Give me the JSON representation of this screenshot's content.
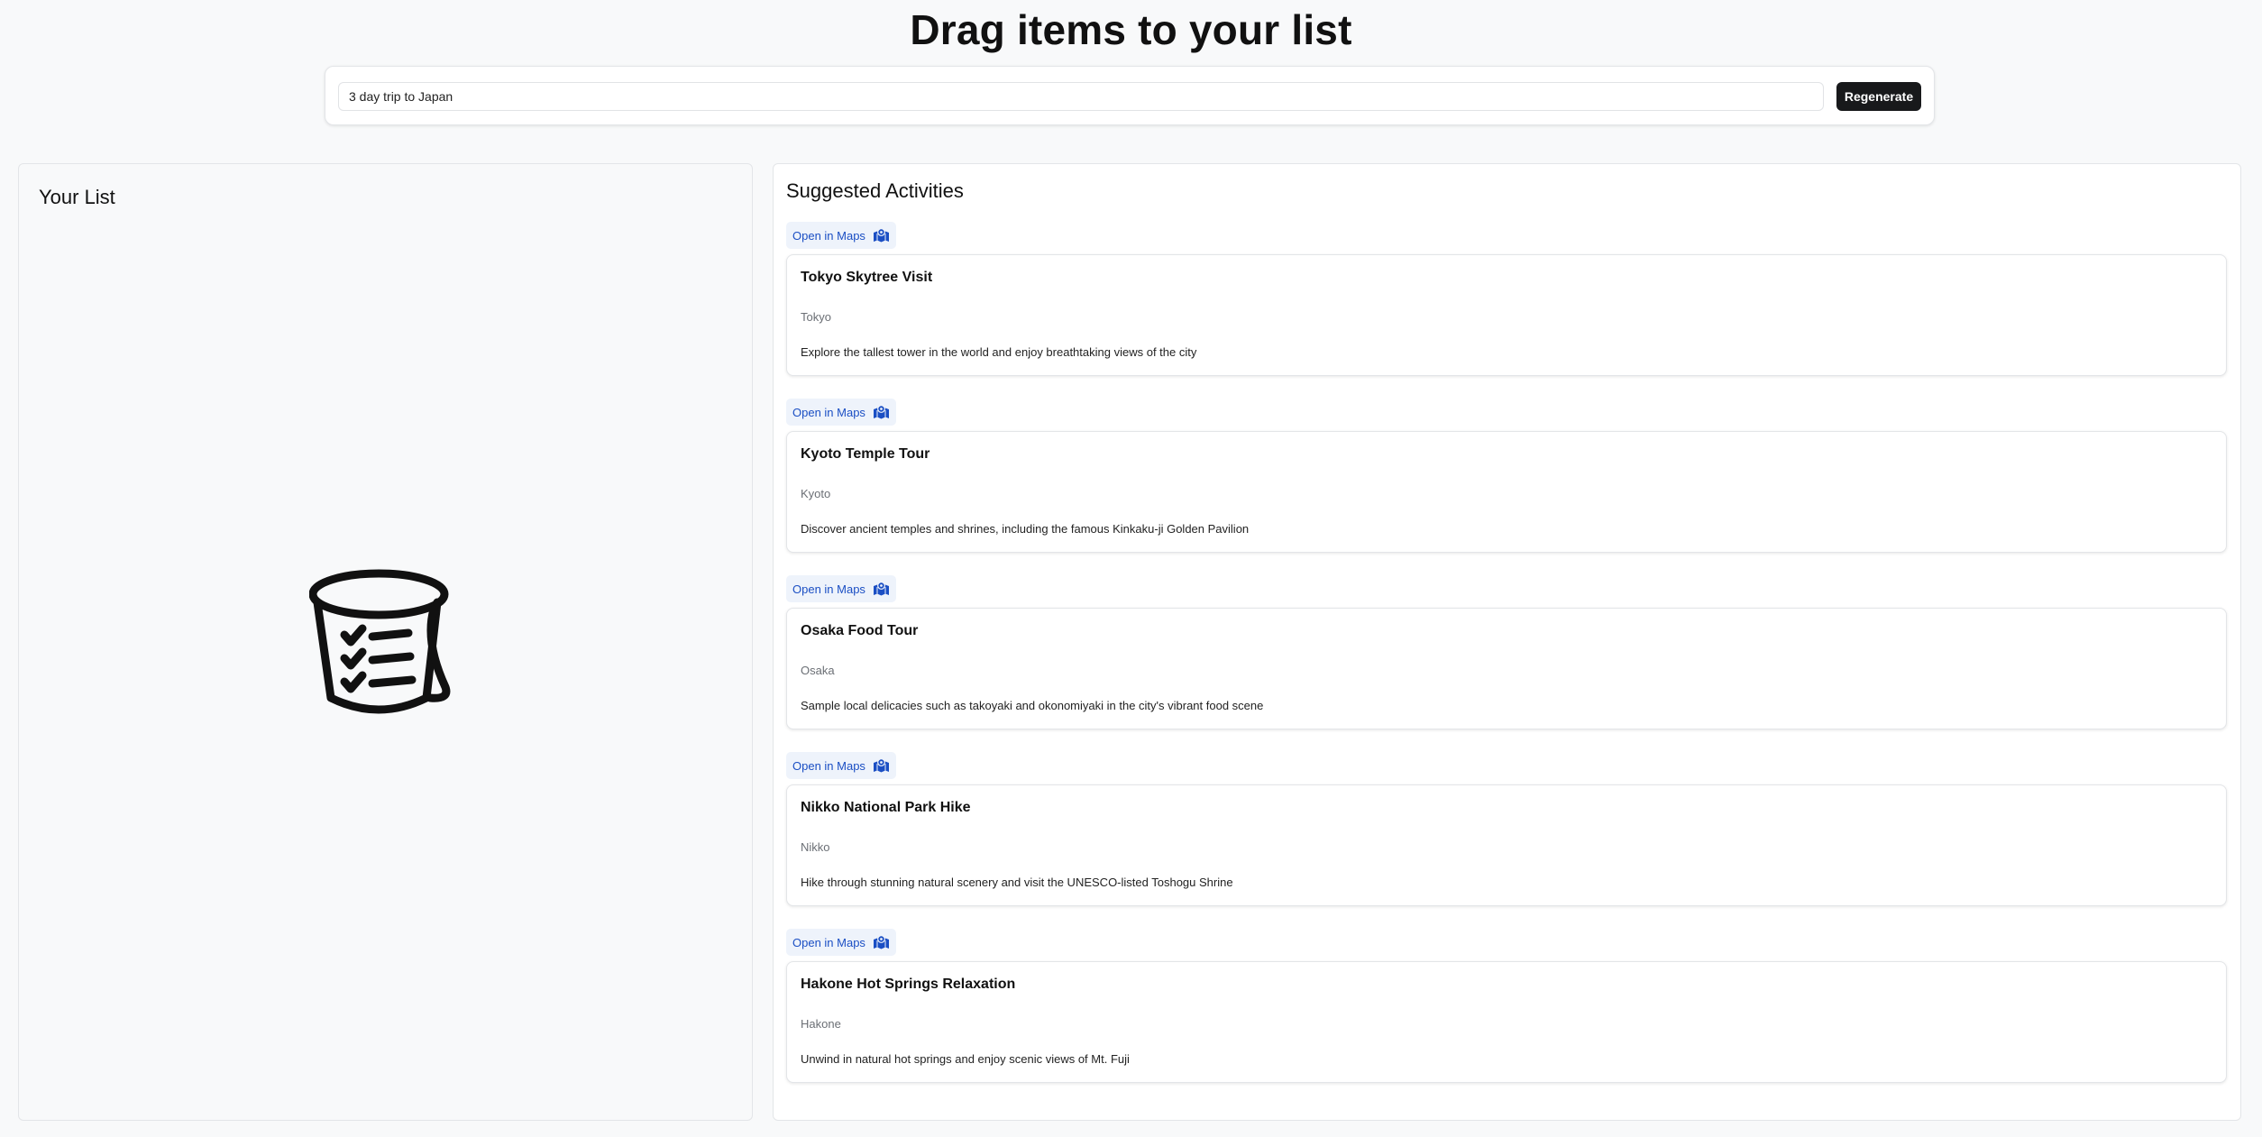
{
  "header": {
    "title": "Drag items to your list"
  },
  "prompt": {
    "value": "3 day trip to Japan",
    "button_label": "Regenerate"
  },
  "your_list": {
    "title": "Your List",
    "empty_icon": "bucket-checklist-icon"
  },
  "suggestions": {
    "title": "Suggested Activities",
    "maps_label": "Open in Maps",
    "maps_icon": "map-pin-icon",
    "accent_color": "#1b4fc4",
    "items": [
      {
        "name": "Tokyo Skytree Visit",
        "location": "Tokyo",
        "description": "Explore the tallest tower in the world and enjoy breathtaking views of the city"
      },
      {
        "name": "Kyoto Temple Tour",
        "location": "Kyoto",
        "description": "Discover ancient temples and shrines, including the famous Kinkaku-ji Golden Pavilion"
      },
      {
        "name": "Osaka Food Tour",
        "location": "Osaka",
        "description": "Sample local delicacies such as takoyaki and okonomiyaki in the city's vibrant food scene"
      },
      {
        "name": "Nikko National Park Hike",
        "location": "Nikko",
        "description": "Hike through stunning natural scenery and visit the UNESCO-listed Toshogu Shrine"
      },
      {
        "name": "Hakone Hot Springs Relaxation",
        "location": "Hakone",
        "description": "Unwind in natural hot springs and enjoy scenic views of Mt. Fuji"
      }
    ]
  }
}
